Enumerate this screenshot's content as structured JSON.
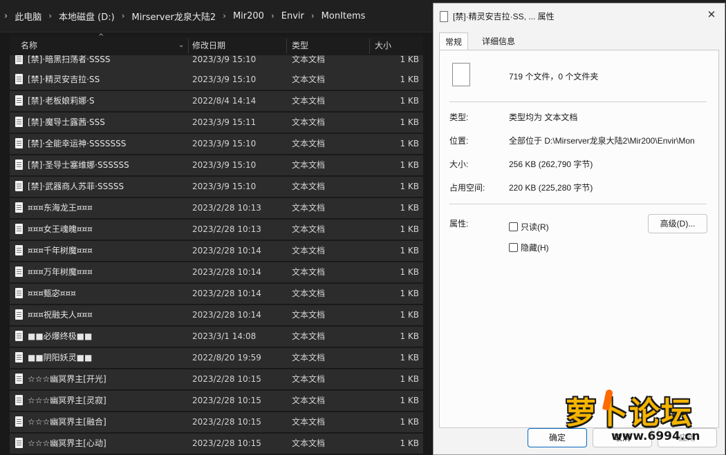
{
  "breadcrumb": [
    "此电脑",
    "本地磁盘 (D:)",
    "Mirserver龙泉大陆2",
    "Mir200",
    "Envir",
    "MonItems"
  ],
  "columns": {
    "name": "名称",
    "date": "修改日期",
    "type": "类型",
    "size": "大小"
  },
  "files": [
    {
      "name": "[禁]·暗黑扫荡者·SSSS",
      "date": "2023/3/9 15:10",
      "type": "文本文档",
      "size": "1 KB"
    },
    {
      "name": "[禁]·精灵安吉拉·SS",
      "date": "2023/3/9 15:10",
      "type": "文本文档",
      "size": "1 KB"
    },
    {
      "name": "[禁]·老板娘莉娜·S",
      "date": "2022/8/4 14:14",
      "type": "文本文档",
      "size": "1 KB"
    },
    {
      "name": "[禁]·魔导士露茜·SSS",
      "date": "2023/3/9 15:11",
      "type": "文本文档",
      "size": "1 KB"
    },
    {
      "name": "[禁]·全能幸运神·SSSSSSS",
      "date": "2023/3/9 15:10",
      "type": "文本文档",
      "size": "1 KB"
    },
    {
      "name": "[禁]·圣导士塞维娜·SSSSSS",
      "date": "2023/3/9 15:10",
      "type": "文本文档",
      "size": "1 KB"
    },
    {
      "name": "[禁]·武器商人苏菲·SSSSS",
      "date": "2023/3/9 15:10",
      "type": "文本文档",
      "size": "1 KB"
    },
    {
      "name": "¤¤¤东海龙王¤¤¤",
      "date": "2023/2/28 10:13",
      "type": "文本文档",
      "size": "1 KB"
    },
    {
      "name": "¤¤¤女王魂魄¤¤¤",
      "date": "2023/2/28 10:13",
      "type": "文本文档",
      "size": "1 KB"
    },
    {
      "name": "¤¤¤千年树魔¤¤¤",
      "date": "2023/2/28 10:14",
      "type": "文本文档",
      "size": "1 KB"
    },
    {
      "name": "¤¤¤万年树魔¤¤¤",
      "date": "2023/2/28 10:14",
      "type": "文本文档",
      "size": "1 KB"
    },
    {
      "name": "¤¤¤甄宓¤¤¤",
      "date": "2023/2/28 10:14",
      "type": "文本文档",
      "size": "1 KB"
    },
    {
      "name": "¤¤¤祝融夫人¤¤¤",
      "date": "2023/2/28 10:14",
      "type": "文本文档",
      "size": "1 KB"
    },
    {
      "name": "■■必爆终极■■",
      "date": "2023/3/1 14:08",
      "type": "文本文档",
      "size": "1 KB"
    },
    {
      "name": "■■阴阳妖灵■■",
      "date": "2022/8/20 19:59",
      "type": "文本文档",
      "size": "1 KB"
    },
    {
      "name": "☆☆☆幽冥界主[开光]",
      "date": "2023/2/28 10:15",
      "type": "文本文档",
      "size": "1 KB"
    },
    {
      "name": "☆☆☆幽冥界主[灵寂]",
      "date": "2023/2/28 10:15",
      "type": "文本文档",
      "size": "1 KB"
    },
    {
      "name": "☆☆☆幽冥界主[融合]",
      "date": "2023/2/28 10:15",
      "type": "文本文档",
      "size": "1 KB"
    },
    {
      "name": "☆☆☆幽冥界主[心动]",
      "date": "2023/2/28 10:15",
      "type": "文本文档",
      "size": "1 KB"
    }
  ],
  "dialog": {
    "title": "[禁]·精灵安吉拉·SS, ... 属性",
    "close_glyph": "✕",
    "tabs": {
      "general": "常规",
      "details": "详细信息"
    },
    "summary": "719 个文件，0 个文件夹",
    "labels": {
      "type": "类型:",
      "location": "位置:",
      "size": "大小:",
      "size_on_disk": "占用空间:",
      "attributes": "属性:"
    },
    "values": {
      "type": "类型均为 文本文档",
      "location": "全部位于 D:\\Mirserver龙泉大陆2\\Mir200\\Envir\\Mon",
      "size": "256 KB (262,790 字节)",
      "size_on_disk": "220 KB (225,280 字节)"
    },
    "readonly_label": "只读(R)",
    "hidden_label": "隐藏(H)",
    "readonly_checked": false,
    "hidden_checked": false,
    "advanced_button": "高级(D)...",
    "ok_button": "确定",
    "cancel_button": "取消",
    "apply_button": "应用"
  },
  "watermark": {
    "logo_text": "萝卜论坛",
    "url": "www.6994.cn"
  },
  "icons": {
    "file": "text-document-icon",
    "close": "close-icon",
    "chevron": "chevron-right-icon"
  },
  "colors": {
    "explorer_bg": "#191919",
    "row_bg": "#2c2c2c",
    "dialog_bg": "#f3f3f3",
    "accent": "#0067c0",
    "watermark": "#f6b400"
  }
}
